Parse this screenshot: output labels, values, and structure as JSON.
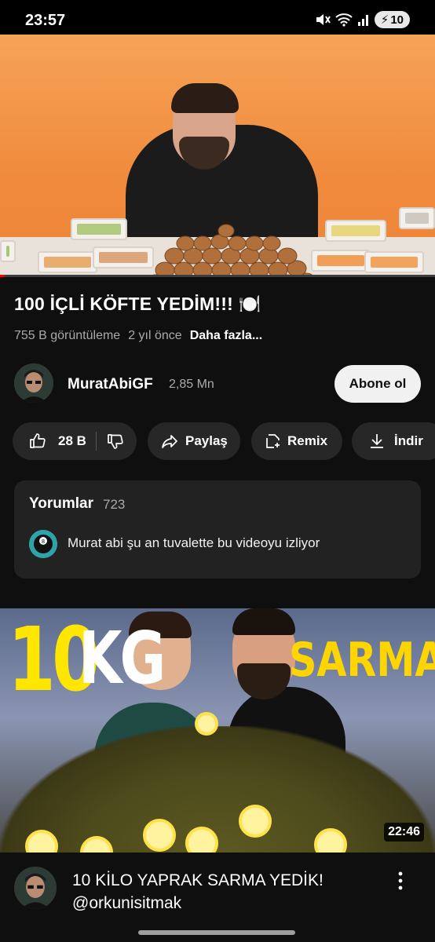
{
  "status_bar": {
    "time": "23:57",
    "battery": "10",
    "icons": [
      "mute-icon",
      "wifi-icon",
      "signal-icon",
      "battery-charging-icon"
    ]
  },
  "video": {
    "progress": 0.01,
    "title": "100 İÇLİ KÖFTE YEDİM!!! 🍽️",
    "views": "755 B görüntüleme",
    "age": "2 yıl önce",
    "more": "Daha fazla..."
  },
  "channel": {
    "name": "MuratAbiGF",
    "subscribers": "2,85 Mn",
    "subscribe_label": "Abone ol"
  },
  "actions": {
    "likes": "28 B",
    "share": "Paylaş",
    "remix": "Remix",
    "download": "İndir"
  },
  "comments": {
    "heading": "Yorumlar",
    "count": "723",
    "top_comment": "Murat abi şu an tuvalette bu videoyu izliyor"
  },
  "next_video": {
    "thumb_text_number": "10",
    "thumb_text_unit": "KG",
    "thumb_text_word": "SARMA",
    "duration": "22:46",
    "title": "10 KİLO YAPRAK SARMA YEDİK!",
    "channel": "@orkunisitmak"
  },
  "colors": {
    "background": "#0f0f0f",
    "chip": "#272727",
    "progress": "#ff0000",
    "subscribe_bg": "#f1f1f1"
  }
}
